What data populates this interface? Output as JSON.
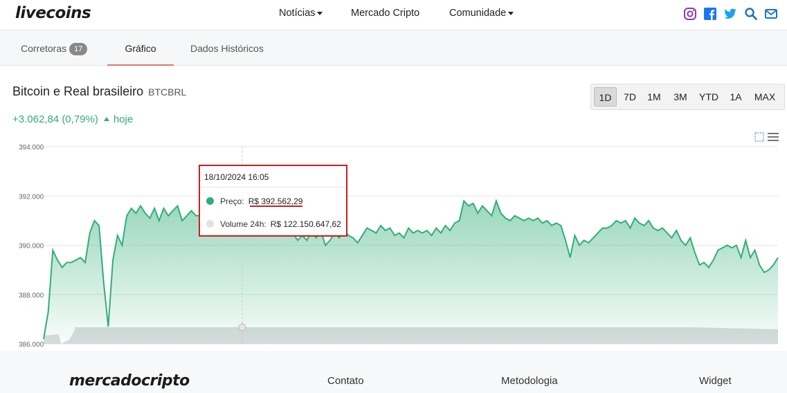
{
  "header": {
    "logo": "livecoins",
    "nav": [
      {
        "label": "Notícias",
        "dropdown": true
      },
      {
        "label": "Mercado Cripto",
        "dropdown": false
      },
      {
        "label": "Comunidade",
        "dropdown": true
      }
    ],
    "social_icons": [
      "instagram-icon",
      "facebook-icon",
      "twitter-icon",
      "search-icon",
      "mail-icon"
    ],
    "brand_colors": {
      "instagram": "#8a3ab9",
      "facebook": "#1877f2",
      "twitter": "#1da1f2",
      "search": "#1a73c8",
      "mail": "#1a73c8"
    }
  },
  "tabs": [
    {
      "label": "Corretoras",
      "badge": "17"
    },
    {
      "label": "Gráfico",
      "active": true
    },
    {
      "label": "Dados Históricos"
    }
  ],
  "pair": {
    "title": "Bitcoin e Real brasileiro",
    "code": "BTCBRL",
    "change": "+3.062,84 (0,79%)",
    "change_period": "hoje",
    "change_color": "#2fae78"
  },
  "ranges": [
    "1D",
    "7D",
    "1M",
    "3M",
    "YTD",
    "1A",
    "MAX"
  ],
  "active_range": "1D",
  "tooltip": {
    "date": "18/10/2024 16:05",
    "price_label": "Preço:",
    "price_value": "R$ 392.562,29",
    "volume_label": "Volume 24h:",
    "volume_value": "R$ 122.150.647,62",
    "highlight_color": "#d11b1b"
  },
  "chart_data": {
    "type": "area",
    "y_ticks": [
      "394.000",
      "392.000",
      "390.000",
      "388.000",
      "386.000"
    ],
    "ylim": [
      386000,
      394000
    ],
    "grid": true,
    "series": [
      {
        "name": "Preço",
        "color": "#2fae78",
        "values": [
          386200,
          387300,
          389800,
          389400,
          389100,
          389300,
          389300,
          389400,
          389500,
          389300,
          390500,
          391000,
          390800,
          388500,
          386700,
          389400,
          390400,
          390000,
          391200,
          391500,
          391300,
          391600,
          391300,
          391100,
          391500,
          391000,
          391500,
          391200,
          391400,
          391600,
          391000,
          391200,
          391400,
          391200,
          391200,
          391700,
          392100,
          391900,
          392200,
          392000,
          391700,
          392100,
          392200,
          392500,
          391400,
          391900,
          392100,
          391600,
          391300,
          391100,
          390900,
          390500,
          390600,
          390700,
          390500,
          390200,
          390400,
          390200,
          390600,
          390300,
          390600,
          390000,
          390200,
          390500,
          390300,
          390600,
          390400,
          390300,
          390100,
          390400,
          390700,
          390600,
          390500,
          390800,
          390600,
          390700,
          390400,
          390500,
          390300,
          390700,
          390500,
          390600,
          390500,
          390600,
          390400,
          390700,
          390500,
          390800,
          390600,
          390900,
          391000,
          391800,
          391600,
          391700,
          391300,
          391600,
          391400,
          391200,
          391800,
          391300,
          391100,
          391000,
          391200,
          391100,
          391000,
          391100,
          391000,
          391100,
          390900,
          391000,
          390800,
          390900,
          390800,
          390200,
          389500,
          390400,
          390000,
          390200,
          390100,
          390300,
          390500,
          390700,
          390700,
          390800,
          391000,
          390900,
          391000,
          390700,
          391100,
          390900,
          390800,
          391000,
          390700,
          390600,
          390700,
          390500,
          390300,
          390600,
          390200,
          390000,
          390300,
          389700,
          389200,
          389300,
          389100,
          389400,
          389800,
          389900,
          390000,
          389900,
          390000,
          389500,
          390200,
          389500,
          389800,
          389200,
          388900,
          389000,
          389200,
          389500
        ]
      },
      {
        "name": "Volume 24h",
        "color": "#c9ced2",
        "values": []
      }
    ]
  },
  "footer": {
    "logo": "mercadocripto",
    "links": [
      "Contato",
      "Metodologia",
      "Widget"
    ]
  }
}
